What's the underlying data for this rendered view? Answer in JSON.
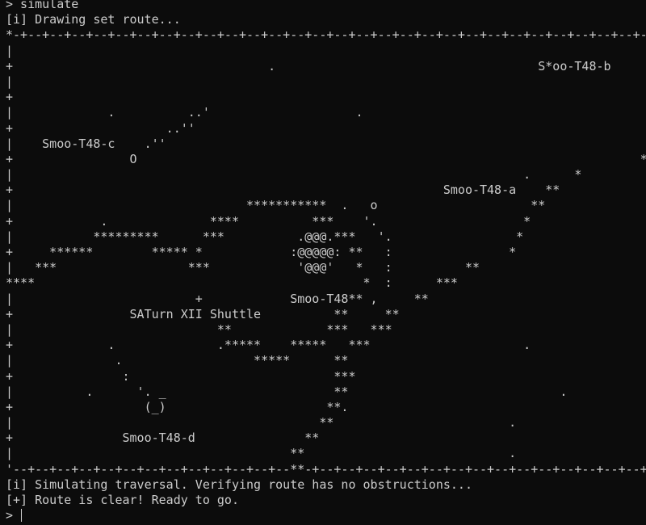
{
  "terminal": {
    "command": "> simulate",
    "status_drawing": "[i] Drawing set route...",
    "map_lines": [
      "*-+--+--+--+--+--+--+--+--+--+--+--+--+--+--+--+--+--+--+--+--+--+--+--+--+--+--+--+--+--+*-+--+--+--+--+--.",
      "|                                                                                          *               |",
      "+                                   .                                    S*oo-T48-b       +",
      "|                                                                                         *   _  _        |",
      "+                                                                                         *_.{_}'         +",
      "|             .          ..'                    .                                         *      '.       |",
      "+                     ..''                                                                *        '.     +",
      "|    Smoo-T48-c    .''                                                                   *          '.    |",
      "+                O                                                                     **           :     +",
      "|                                                                      .      *                     :     |",
      "+                                                           Smoo-T48-a    **                        :     +",
      "|                                ***********  .   o                     **                        '     |",
      "+            .              ****          ***    '.                    *                                +",
      "|           *********      ***          .@@@.***   '.                 *                                 |",
      "+     ******        ***** *            :@@@@@: **   :                *                                  +",
      "|   ***                  ***            '@@@'   *   :          **                          .            |",
      "****                                             *  :      ***                                          +",
      "|                         +            Smoo-T48** ,     **                                               |",
      "+                SATurn XII Shuttle          **     **                                                   +",
      "|                            **             ***   ***                                                    |",
      "+             .              .*****    *****   ***                     .                                 +",
      "|              .                  *****      **                                                          |",
      "+               :                            ***                                                         +",
      "|          .      '. _                       **                             .                            |",
      "+                  (_)                      **.                                                          +",
      "|                                          **                        .                                   |",
      "+               Smoo-T48-d               **                                                              +",
      "|                                      **                            .                                   |",
      "'--+--+--+--+--+--+--+--+--+--+--+--+--**-+--+--+--+--+--+--+--+--+--+--+--+--+--+--+--+--+--+--+--+--+--'"
    ],
    "status_simulating": "[i] Simulating traversal. Verifying route has no obstructions...",
    "status_clear": "[+] Route is clear! Ready to go.",
    "prompt": "> "
  },
  "colors": {
    "background": "#0c0c0c",
    "foreground": "#cccccc"
  }
}
